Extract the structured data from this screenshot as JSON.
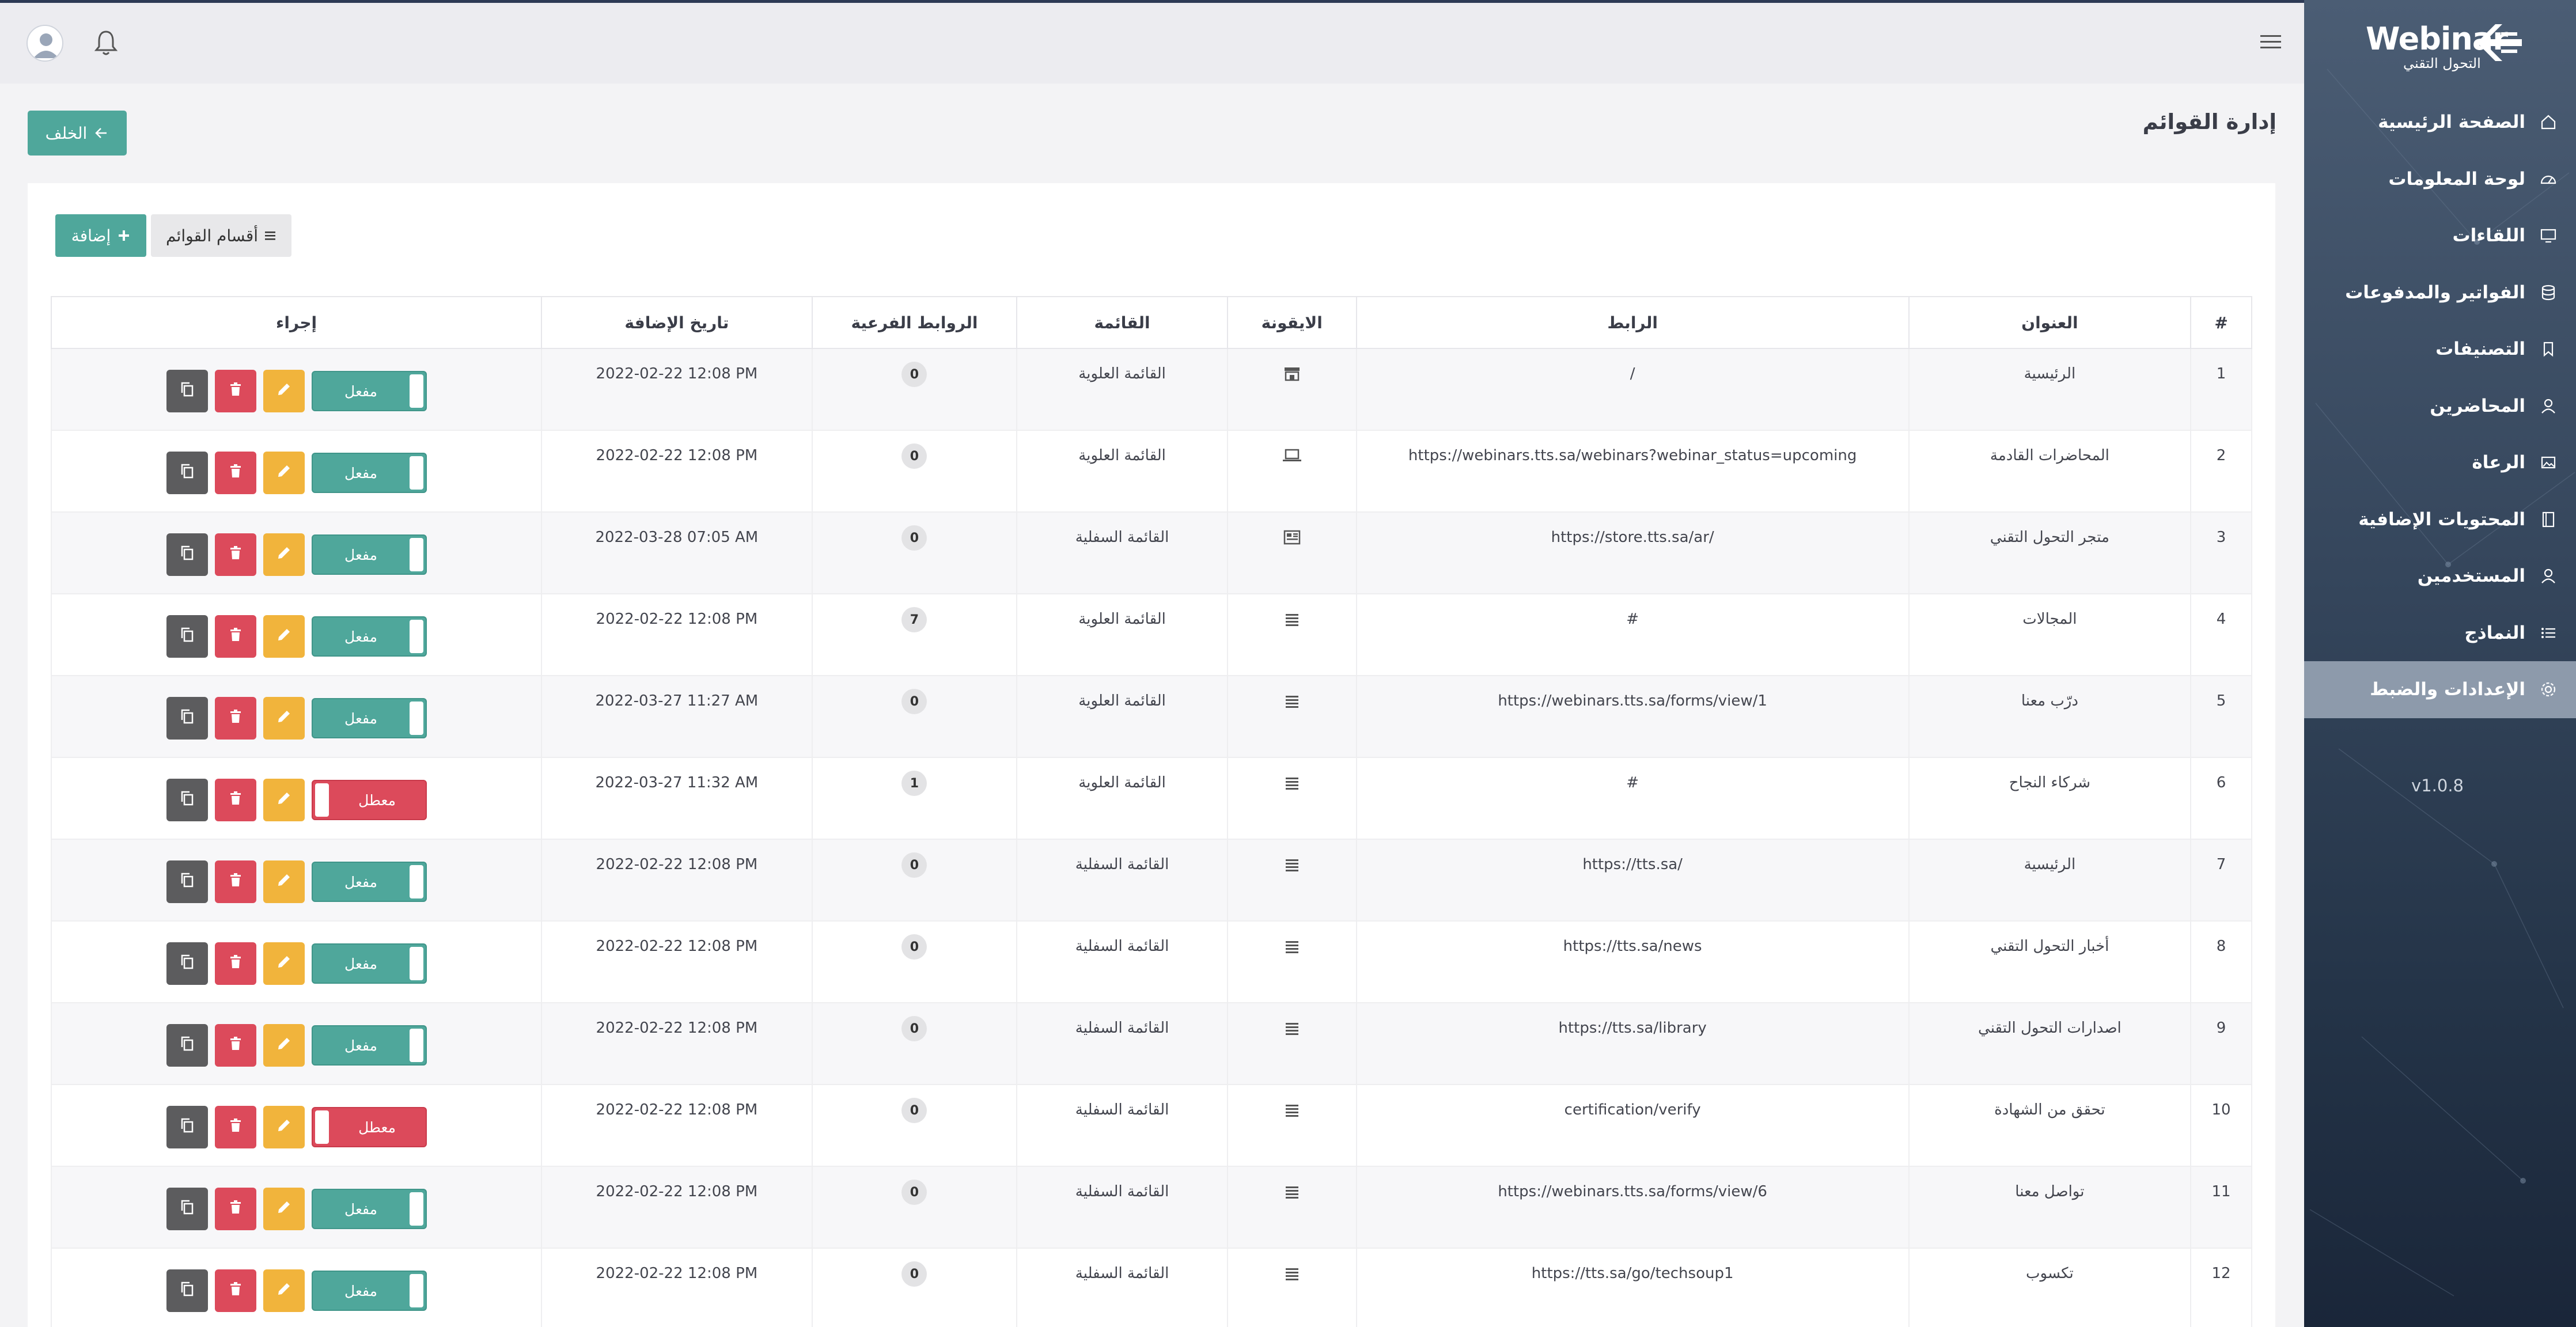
{
  "sidebar": {
    "logo_text": "Webinar",
    "logo_subtext": "التحول التقني",
    "items": [
      {
        "label": "الصفحة الرئيسية",
        "icon": "home-icon"
      },
      {
        "label": "لوحة المعلومات",
        "icon": "dashboard-icon"
      },
      {
        "label": "اللقاءات",
        "icon": "monitor-icon"
      },
      {
        "label": "الفواتير والمدفوعات",
        "icon": "database-icon"
      },
      {
        "label": "التصنيفات",
        "icon": "bookmark-icon"
      },
      {
        "label": "المحاضرين",
        "icon": "user-icon"
      },
      {
        "label": "الرعاة",
        "icon": "image-icon"
      },
      {
        "label": "المحتويات الإضافية",
        "icon": "book-icon"
      },
      {
        "label": "المستخدمين",
        "icon": "user-icon"
      },
      {
        "label": "النماذج",
        "icon": "list-icon"
      },
      {
        "label": "الإعدادات والضبط",
        "icon": "gear-icon"
      }
    ],
    "active_index": 10,
    "version": "v1.0.8"
  },
  "page": {
    "title": "إدارة القوائم",
    "back_label": "الخلف",
    "add_label": "إضافة",
    "categories_label": "أقسام القوائم"
  },
  "table": {
    "headers": {
      "num": "#",
      "title": "العنوان",
      "link": "الرابط",
      "icon": "الايقونة",
      "menu": "القائمة",
      "sublinks": "الروابط الفرعية",
      "date": "تاريخ الإضافة",
      "action": "إجراء"
    },
    "rows": [
      {
        "num": "1",
        "title": "الرئيسية",
        "link": "/",
        "icon": "store-icon",
        "menu": "القائمة العلوية",
        "sublinks": "0",
        "date": "2022-02-22 12:08 PM",
        "status": "مفعل",
        "enabled": true
      },
      {
        "num": "2",
        "title": "المحاضرات القادمة",
        "link": "https://webinars.tts.sa/webinars?webinar_status=upcoming",
        "icon": "laptop-icon",
        "menu": "القائمة العلوية",
        "sublinks": "0",
        "date": "2022-02-22 12:08 PM",
        "status": "مفعل",
        "enabled": true
      },
      {
        "num": "3",
        "title": "متجر التحول التقني",
        "link": "https://store.tts.sa/ar/",
        "icon": "shop-icon",
        "menu": "القائمة السفلية",
        "sublinks": "0",
        "date": "2022-03-28 07:05 AM",
        "status": "مفعل",
        "enabled": true
      },
      {
        "num": "4",
        "title": "المجالات",
        "link": "#",
        "icon": "menu-icon",
        "menu": "القائمة العلوية",
        "sublinks": "7",
        "date": "2022-02-22 12:08 PM",
        "status": "مفعل",
        "enabled": true
      },
      {
        "num": "5",
        "title": "درّب معنا",
        "link": "https://webinars.tts.sa/forms/view/1",
        "icon": "menu-icon",
        "menu": "القائمة العلوية",
        "sublinks": "0",
        "date": "2022-03-27 11:27 AM",
        "status": "مفعل",
        "enabled": true
      },
      {
        "num": "6",
        "title": "شركاء النجاح",
        "link": "#",
        "icon": "menu-icon",
        "menu": "القائمة العلوية",
        "sublinks": "1",
        "date": "2022-03-27 11:32 AM",
        "status": "معطل",
        "enabled": false
      },
      {
        "num": "7",
        "title": "الرئيسية",
        "link": "https://tts.sa/",
        "icon": "menu-icon",
        "menu": "القائمة السفلية",
        "sublinks": "0",
        "date": "2022-02-22 12:08 PM",
        "status": "مفعل",
        "enabled": true
      },
      {
        "num": "8",
        "title": "أخبار التحول التقني",
        "link": "https://tts.sa/news",
        "icon": "menu-icon",
        "menu": "القائمة السفلية",
        "sublinks": "0",
        "date": "2022-02-22 12:08 PM",
        "status": "مفعل",
        "enabled": true
      },
      {
        "num": "9",
        "title": "اصدارات التحول التقني",
        "link": "https://tts.sa/library",
        "icon": "menu-icon",
        "menu": "القائمة السفلية",
        "sublinks": "0",
        "date": "2022-02-22 12:08 PM",
        "status": "مفعل",
        "enabled": true
      },
      {
        "num": "10",
        "title": "تحقق من الشهادة",
        "link": "certification/verify",
        "icon": "menu-icon",
        "menu": "القائمة السفلية",
        "sublinks": "0",
        "date": "2022-02-22 12:08 PM",
        "status": "معطل",
        "enabled": false
      },
      {
        "num": "11",
        "title": "تواصل معنا",
        "link": "https://webinars.tts.sa/forms/view/6",
        "icon": "menu-icon",
        "menu": "القائمة السفلية",
        "sublinks": "0",
        "date": "2022-02-22 12:08 PM",
        "status": "مفعل",
        "enabled": true
      },
      {
        "num": "12",
        "title": "تكسوب",
        "link": "https://tts.sa/go/techsoup1",
        "icon": "menu-icon",
        "menu": "القائمة السفلية",
        "sublinks": "0",
        "date": "2022-02-22 12:08 PM",
        "status": "مفعل",
        "enabled": true
      }
    ]
  },
  "colors": {
    "accent": "#4fa79b",
    "danger": "#dc4a5b",
    "warning": "#f1b43c",
    "dark": "#5c5c5e",
    "sidebar_active": "#8d9aab"
  }
}
